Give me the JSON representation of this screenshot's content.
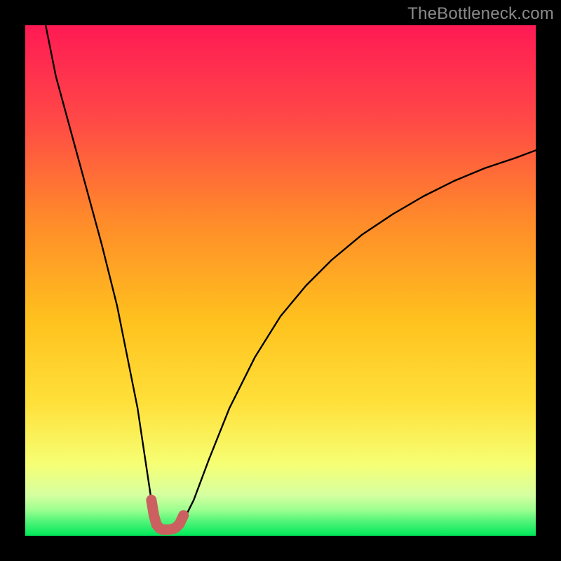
{
  "watermark": "TheBottleneck.com",
  "chart_data": {
    "type": "line",
    "title": "",
    "xlabel": "",
    "ylabel": "",
    "xlim": [
      0,
      100
    ],
    "ylim": [
      0,
      100
    ],
    "grid": false,
    "legend": false,
    "colors": {
      "gradient_top": "#ff1a54",
      "gradient_mid": "#ffd400",
      "gradient_low": "#f6ff74",
      "gradient_band": "#9bff8f",
      "gradient_bottom": "#00e85a",
      "curve": "#000000",
      "marker": "#cc6060"
    },
    "series": [
      {
        "name": "bottleneck-curve",
        "x": [
          4,
          6,
          9,
          12,
          15,
          18,
          20,
          22,
          23.5,
          24.7,
          25.4,
          26,
          27,
          28,
          29,
          30,
          31,
          33,
          36,
          40,
          45,
          50,
          55,
          60,
          66,
          72,
          78,
          84,
          90,
          96,
          100
        ],
        "y": [
          100,
          90,
          79,
          68,
          57,
          45,
          35,
          25,
          15,
          7,
          3,
          1.5,
          1.2,
          1.2,
          1.3,
          1.7,
          3,
          7,
          15,
          25,
          35,
          43,
          49,
          54,
          59,
          63,
          66.5,
          69.5,
          72,
          74,
          75.5
        ]
      },
      {
        "name": "highlight-marker",
        "x": [
          24.7,
          25.2,
          25.7,
          26.3,
          26.9,
          27.5,
          28.1,
          28.8,
          29.5,
          30.2,
          31.0
        ],
        "y": [
          7.0,
          4.0,
          2.2,
          1.5,
          1.2,
          1.2,
          1.2,
          1.3,
          1.6,
          2.3,
          4.0
        ]
      }
    ]
  }
}
